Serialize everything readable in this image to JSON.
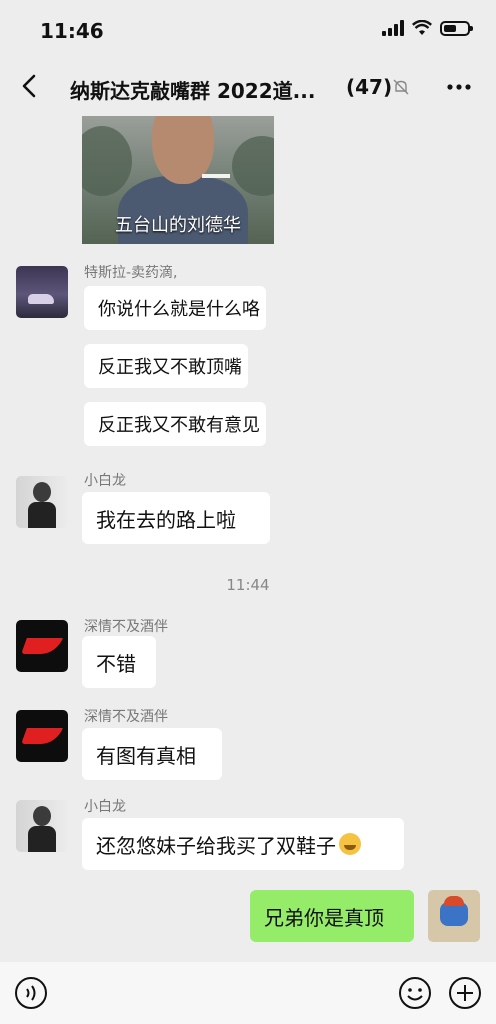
{
  "status": {
    "time": "11:46"
  },
  "nav": {
    "title": "纳斯达克敲嘴群 2022道...",
    "count": "(47)"
  },
  "image_caption": "五台山的刘德华",
  "messages": [
    {
      "sender": "特斯拉-卖药滴,",
      "bubbles": [
        "你说什么就是什么咯",
        "反正我又不敢顶嘴",
        "反正我又不敢有意见"
      ]
    },
    {
      "sender": "小白龙",
      "bubbles": [
        "我在去的路上啦"
      ]
    },
    {
      "timestamp": "11:44"
    },
    {
      "sender": "深情不及酒伴",
      "bubbles": [
        "不错"
      ]
    },
    {
      "sender": "深情不及酒伴",
      "bubbles": [
        "有图有真相"
      ]
    },
    {
      "sender": "小白龙",
      "bubbles": [
        "还忽悠妹子给我买了双鞋子"
      ],
      "emoji": "laugh-cry-icon"
    },
    {
      "mine": true,
      "bubbles": [
        "兄弟你是真顶"
      ]
    }
  ],
  "colors": {
    "background": "#ededed",
    "my_bubble": "#95ec69",
    "bubble": "#ffffff"
  }
}
